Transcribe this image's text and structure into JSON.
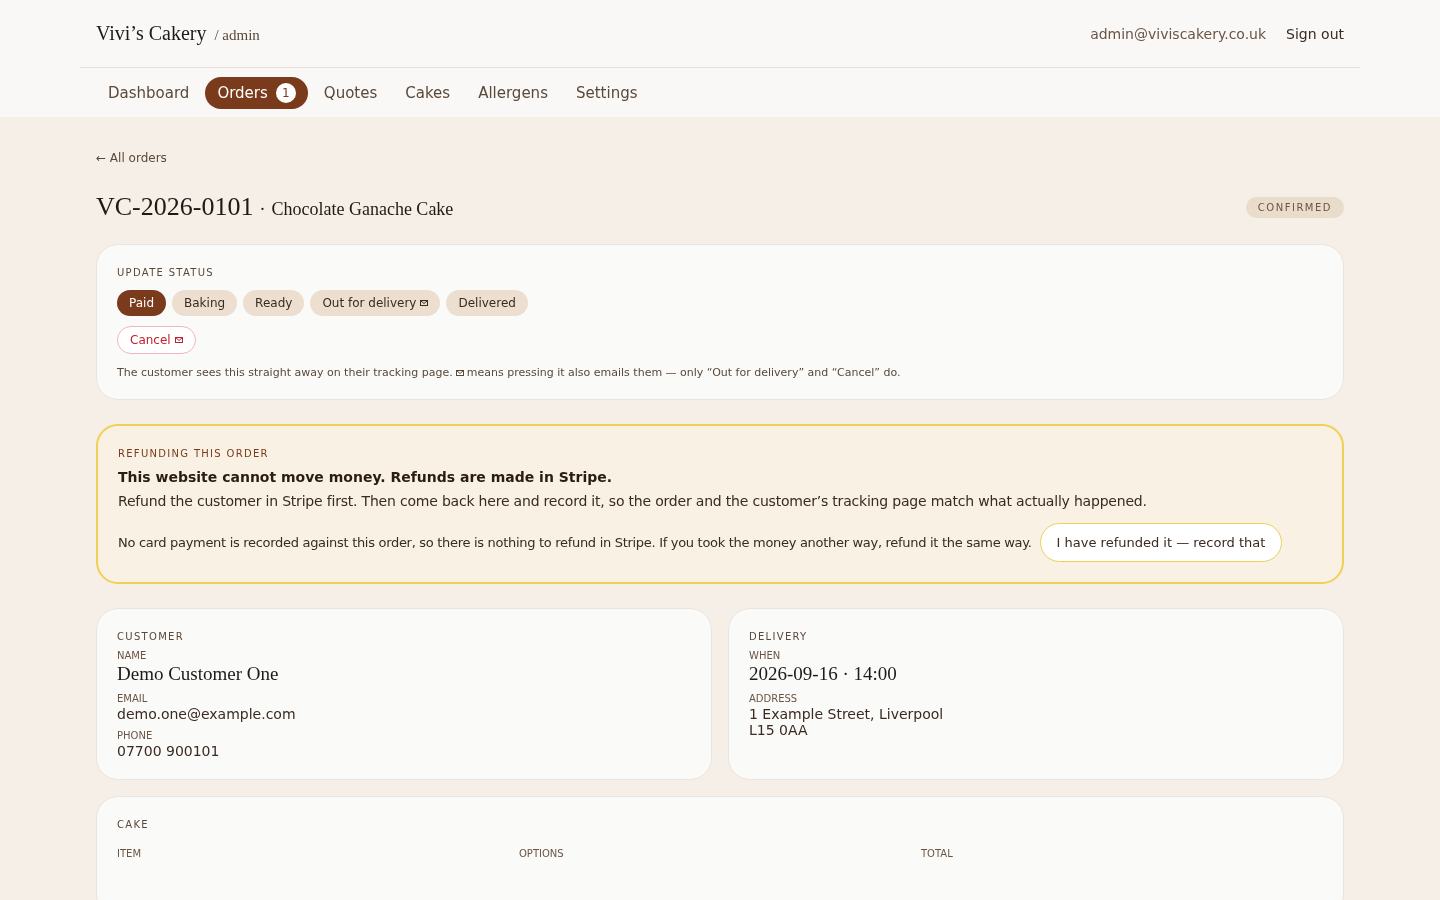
{
  "brand": {
    "name": "Vivi’s Cakery",
    "suffix": "/ admin"
  },
  "account": {
    "email": "admin@viviscakery.co.uk",
    "sign_out": "Sign out"
  },
  "nav": [
    {
      "label": "Dashboard",
      "selected": false
    },
    {
      "label": "Orders",
      "selected": true,
      "count": "1"
    },
    {
      "label": "Quotes",
      "selected": false
    },
    {
      "label": "Cakes",
      "selected": false
    },
    {
      "label": "Allergens",
      "selected": false
    },
    {
      "label": "Settings",
      "selected": false
    }
  ],
  "back_link": "← All orders",
  "order": {
    "number": "VC-2026-0101",
    "separator": "·",
    "cake": "Chocolate Ganache Cake",
    "status": "CONFIRMED"
  },
  "update_status": {
    "title": "UPDATE STATUS",
    "steps": [
      {
        "label": "Paid",
        "selected": true,
        "emails": false
      },
      {
        "label": "Baking",
        "selected": false,
        "emails": false
      },
      {
        "label": "Ready",
        "selected": false,
        "emails": false
      },
      {
        "label": "Out for delivery",
        "selected": false,
        "emails": true
      },
      {
        "label": "Delivered",
        "selected": false,
        "emails": false
      }
    ],
    "cancel": {
      "label": "Cancel",
      "emails": true
    },
    "note_before": "The customer sees this straight away on their tracking page.",
    "note_after": "means pressing it also emails them — only “Out for delivery” and “Cancel” do."
  },
  "refund": {
    "title": "REFUNDING THIS ORDER",
    "headline": "This website cannot move money. Refunds are made in Stripe.",
    "body": "Refund the customer in Stripe first. Then come back here and record it, so the order and the customer’s tracking page match what actually happened.",
    "notice": "No card payment is recorded against this order, so there is nothing to refund in Stripe. If you took the money another way, refund it the same way.",
    "button": "I have refunded it — record that"
  },
  "customer": {
    "title": "CUSTOMER",
    "fields": [
      {
        "label": "NAME",
        "value": "Demo Customer One",
        "kind": "serif"
      },
      {
        "label": "EMAIL",
        "value": "demo.one@example.com",
        "kind": "plain"
      },
      {
        "label": "PHONE",
        "value": "07700 900101",
        "kind": "plain"
      }
    ]
  },
  "delivery": {
    "title": "DELIVERY",
    "fields": [
      {
        "label": "WHEN",
        "value": "2026-09-16 · 14:00",
        "kind": "serif"
      },
      {
        "label": "ADDRESS",
        "value": "1 Example Street, Liverpool\nL15 0AA",
        "kind": "plain"
      }
    ]
  },
  "cake": {
    "title": "CAKE",
    "columns": [
      "ITEM",
      "OPTIONS",
      "TOTAL"
    ]
  }
}
